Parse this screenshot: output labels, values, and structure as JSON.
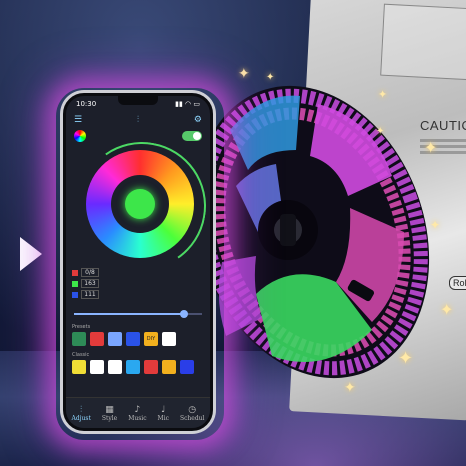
{
  "phone": {
    "status_time": "10:30",
    "status_right": "▮▮ ◠ ▭",
    "appbar": {
      "menu_icon": "menu-icon",
      "center_icon": "sliders-icon",
      "right_icon": "gear-icon"
    },
    "rgb": {
      "r_value": "0/8",
      "g_value": "163",
      "b_value": "111"
    },
    "brightness_fraction": 0.86,
    "swatch_sections": [
      {
        "label": "Presets",
        "colors": [
          "#2e8b57",
          "#e23b3b",
          "#7aa6ff",
          "#2a52e8",
          "#f2b01e",
          "#ffffff"
        ],
        "custom_tag": "DIY"
      },
      {
        "label": "Classic",
        "colors": [
          "#f0dd36",
          "#ffffff",
          "#ffffff",
          "#2aa8f0",
          "#e23b3b",
          "#f2b01e",
          "#2a3ee8"
        ]
      }
    ],
    "tabs": [
      {
        "label": "Adjust",
        "icon": "sliders-icon",
        "active": true
      },
      {
        "label": "Style",
        "icon": "grid-icon"
      },
      {
        "label": "Music",
        "icon": "music-note-icon"
      },
      {
        "label": "Mic",
        "icon": "microphone-icon"
      },
      {
        "label": "Schedul",
        "icon": "clock-icon"
      }
    ]
  },
  "bag": {
    "caution_text": "CAUTION",
    "tag_text": "RoH"
  },
  "overlay": {
    "play_icon": "play-icon"
  }
}
